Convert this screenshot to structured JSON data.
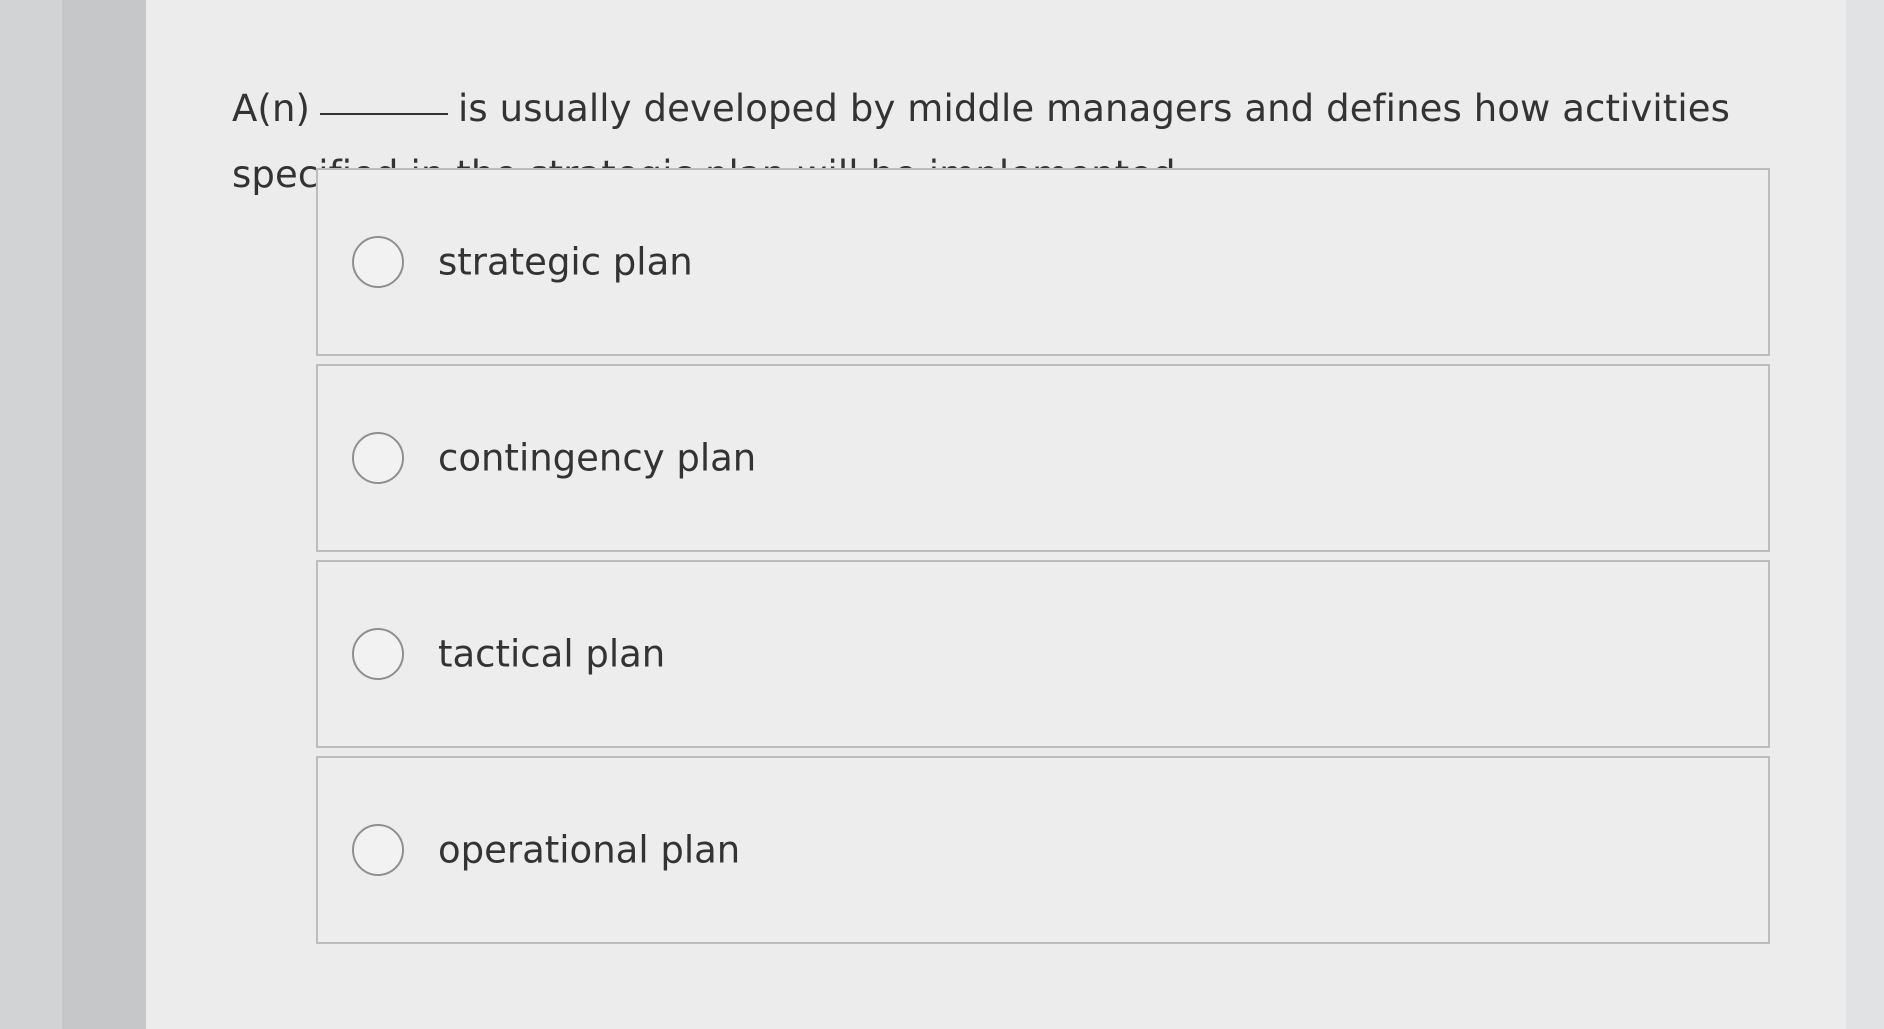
{
  "question": {
    "prefix": "A(n)",
    "suffix": "is usually developed by middle managers and defines how activities specified in the strategic plan will be implemented."
  },
  "options": [
    {
      "label": "strategic plan"
    },
    {
      "label": "contingency plan"
    },
    {
      "label": "tactical plan"
    },
    {
      "label": "operational plan"
    }
  ]
}
